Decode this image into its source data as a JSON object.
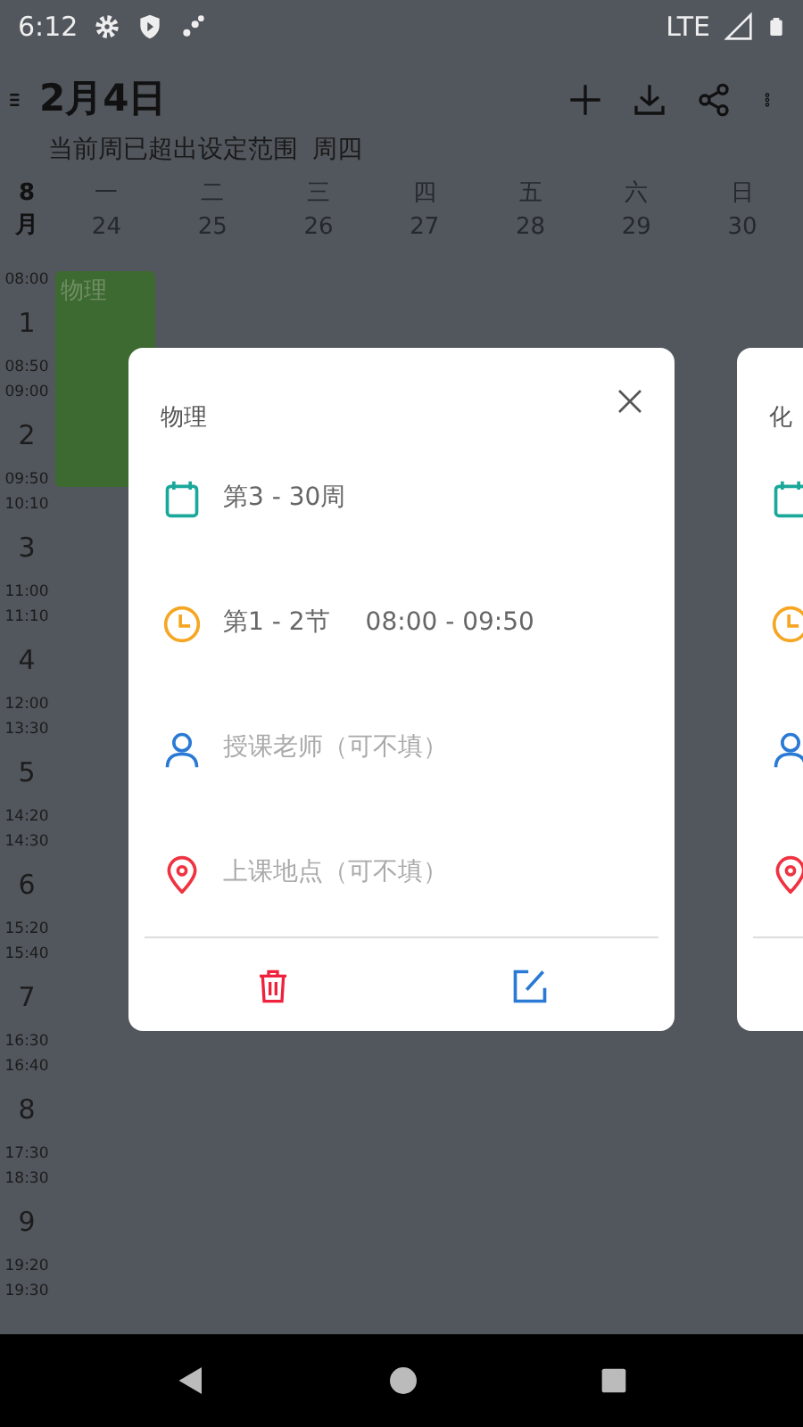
{
  "status_bar": {
    "time": "6:12",
    "network": "LTE"
  },
  "header": {
    "title": "2月4日",
    "subtitle": "当前周已超出设定范围",
    "weekday": "周四"
  },
  "month": {
    "number": "8",
    "unit": "月"
  },
  "days": [
    {
      "name": "一",
      "date": "24"
    },
    {
      "name": "二",
      "date": "25"
    },
    {
      "name": "三",
      "date": "26"
    },
    {
      "name": "四",
      "date": "27"
    },
    {
      "name": "五",
      "date": "28"
    },
    {
      "name": "六",
      "date": "29"
    },
    {
      "name": "日",
      "date": "30"
    }
  ],
  "periods": [
    {
      "number": "1",
      "start": "08:00",
      "end": "08:50"
    },
    {
      "number": "2",
      "start": "09:00",
      "end": "09:50"
    },
    {
      "number": "3",
      "start": "10:10",
      "end": "11:00"
    },
    {
      "number": "4",
      "start": "11:10",
      "end": "12:00"
    },
    {
      "number": "5",
      "start": "13:30",
      "end": "14:20"
    },
    {
      "number": "6",
      "start": "14:30",
      "end": "15:20"
    },
    {
      "number": "7",
      "start": "15:40",
      "end": "16:30"
    },
    {
      "number": "8",
      "start": "16:40",
      "end": "17:30"
    },
    {
      "number": "9",
      "start": "18:30",
      "end": "19:20"
    },
    {
      "start": "19:30"
    }
  ],
  "courses": [
    {
      "name": "物理"
    }
  ],
  "cards": [
    {
      "title": "物理",
      "weeks": "第3 - 30周",
      "sessions": "第1 - 2节",
      "time": "08:00 - 09:50",
      "teacher_placeholder": "授课老师（可不填）",
      "location_placeholder": "上课地点（可不填）"
    },
    {
      "title": "化"
    }
  ]
}
